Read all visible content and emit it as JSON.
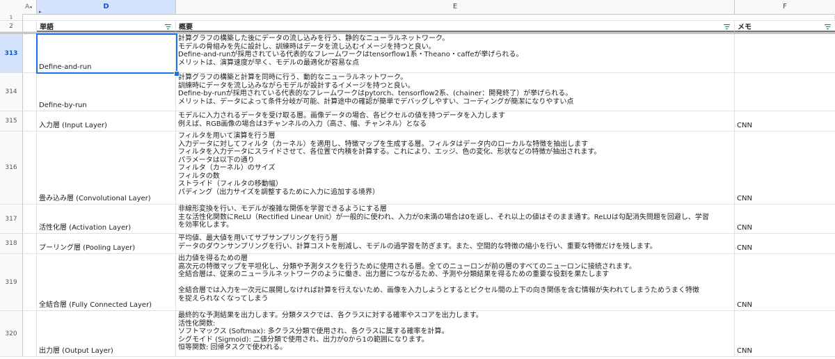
{
  "columns": {
    "hidden_a": "A",
    "d": "D",
    "e": "E",
    "f": "F"
  },
  "row_numbers": {
    "r1": "1",
    "r2": "2"
  },
  "header": {
    "word": "単語",
    "summary": "概要",
    "memo": "メモ"
  },
  "rows": [
    {
      "num": "313",
      "word": "Define-and-run",
      "summary": "計算グラフの構築した後にデータの流し込みを行う、静的なニューラルネットワーク。\nモデルの骨組みを先に設計し、訓練時はデータを流し込むイメージを持つと良い。\nDefine-and-runが採用されている代表的なフレームワークはtensorflow1系・Theano・caffeが挙げられる。\nメリットは、演算速度が早く、モデルの最適化が容易な点",
      "memo": ""
    },
    {
      "num": "314",
      "word": "Define-by-run",
      "summary": "計算グラフの構築と計算を同時に行う、動的なニューラルネットワーク。\n訓練時にデータを流し込みながらモデルが設計するイメージを持つと良い。\nDefine-by-runが採用されている代表的なフレームワークはpytorch、tensorflow2系、(chainer：開発終了）が挙げられる。\nメリットは、データによって条件分岐が可能、計算途中の確認が簡単でデバッグしやすい、コーディングが簡潔になりやすい点",
      "memo": ""
    },
    {
      "num": "315",
      "word": "入力層 (Input Layer)",
      "summary": "モデルに入力されるデータを受け取る層。画像データの場合、各ピクセルの値を持つデータを入力します\n例えば、RGB画像の場合は3チャンネルの入力（高さ、幅、チャンネル）となる",
      "memo": "CNN"
    },
    {
      "num": "316",
      "word": "畳み込み層 (Convolutional Layer)",
      "summary": "フィルタを用いて演算を行う層\n入力データに対してフィルタ（カーネル）を適用し、特徴マップを生成する層。フィルタはデータ内のローカルな特徴を抽出します\nフィルタを入力データにスライドさせて、各位置で内積を計算する。これにより、エッジ、色の変化、形状などの特徴が抽出されます。\nパラメータは以下の通り\nフィルタ（カーネル）のサイズ\nフィルタの数\nストライド（フィルタの移動幅）\nパディング（出力サイズを調整するために入力に追加する境界）",
      "memo": "CNN"
    },
    {
      "num": "317",
      "word": "活性化層 (Activation Layer)",
      "summary": "非線形変換を行い、モデルが複雑な関係を学習できるようにする層\n主な活性化関数にReLU（Rectified Linear Unit）が一般的に使われ、入力が0未満の場合は0を返し、それ以上の値はそのまま通す。ReLUは勾配消失問題を回避し、学習\nを効率化します。",
      "memo": "CNN"
    },
    {
      "num": "318",
      "word": "プーリング層 (Pooling Layer)",
      "summary": "平均値、最大値を用いてサブサンプリングを行う層\nデータのダウンサンプリングを行い、計算コストを削減し、モデルの過学習を防ぎます。また、空間的な特徴の縮小を行い、重要な特徴だけを残します。",
      "memo": "CNN"
    },
    {
      "num": "319",
      "word": "全結合層 (Fully Connected Layer)",
      "summary": "出力値を得るための層\n高次元の特徴マップを平坦化し、分類や予測タスクを行うために使用される層。全てのニューロンが前の層のすべてのニューロンに接続されます。\n全結合層は、従来のニューラルネットワークのように働き、出力層につながるため、予測や分類結果を得るための重要な役割を果たします\n\n全結合層では入力を一次元に展開しなければ計算を行えないため、画像を入力しようとするとピクセル間の上下の向き関係を含む情報が失われてしまうためうまく特徴\nを捉えられなくなってしまう",
      "memo": "CNN"
    },
    {
      "num": "320",
      "word": "出力層 (Output Layer)",
      "summary": "最終的な予測結果を出力します。分類タスクでは、各クラスに対する確率やスコアを出力します。\n活性化関数:\nソフトマックス (Softmax): 多クラス分類で使用され、各クラスに属する確率を計算。\nシグモイド (Sigmoid): 二値分類で使用され、出力が0から1の範囲になります。\n恒等関数: 回帰タスクで使われる。",
      "memo": "CNN"
    }
  ]
}
